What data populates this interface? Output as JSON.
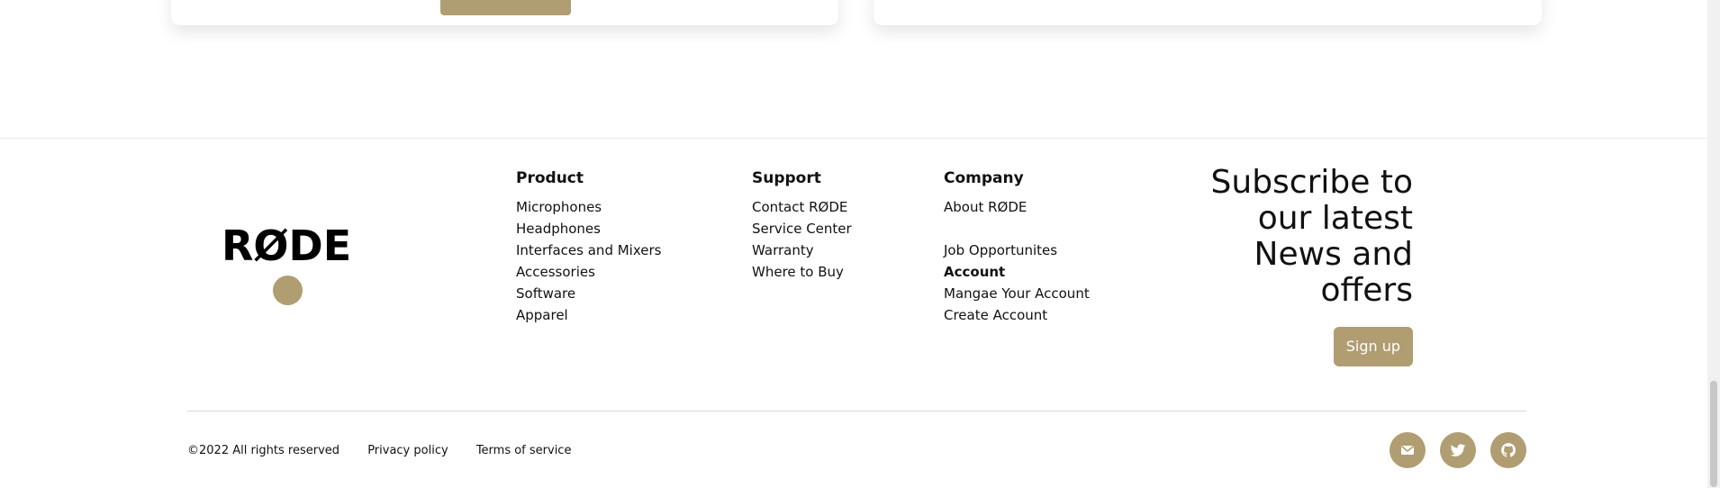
{
  "brand": {
    "logo_text": "RØDE",
    "accent_color": "#b09d72"
  },
  "footer": {
    "columns": [
      {
        "heading": "Product",
        "links": [
          "Microphones",
          "Headphones",
          "Interfaces and Mixers",
          "Accessories",
          "Software",
          "Apparel"
        ]
      },
      {
        "heading": "Support",
        "links": [
          "Contact RØDE",
          "Service Center",
          "Warranty",
          "Where to Buy"
        ]
      },
      {
        "heading": "Company",
        "links": [
          "About RØDE",
          "Job Opportunites"
        ],
        "account_heading": "Account",
        "account_links": [
          "Mangae Your Account",
          "Create Account"
        ]
      }
    ],
    "subscribe": {
      "title": "Subscribe to our latest News and offers",
      "button_label": "Sign up"
    },
    "legal": {
      "copyright": "©2022 All rights reserved",
      "privacy": "Privacy policy",
      "terms": "Terms of service"
    },
    "social_icons": [
      "mail-icon",
      "twitter-icon",
      "github-icon"
    ]
  }
}
